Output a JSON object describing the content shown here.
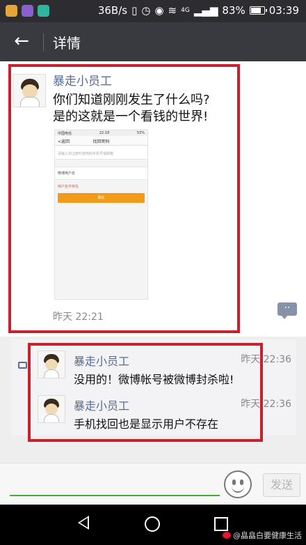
{
  "status_bar": {
    "speed": "36B/s",
    "network": "4G",
    "battery": "83%",
    "time": "03:39",
    "battery_level": 0.83
  },
  "header": {
    "back_icon": "arrow-left-icon",
    "title": "详情"
  },
  "post": {
    "author": "暴走小员工",
    "text": "你们知道刚刚发生了什么吗?\n是的这就是一个看钱的世界!",
    "screenshot": {
      "carrier": "中国电信",
      "time": "22:18",
      "battery": "53%",
      "back": "<返回",
      "title": "找回密码",
      "hint": "请输入你注册时使用的手机号或邮箱",
      "field": "微博用户名",
      "error": "用户名不存在",
      "button": "确定"
    },
    "time": "昨天 22:21"
  },
  "comments": [
    {
      "author": "暴走小员工",
      "time": "昨天 22:36",
      "text": "没用的！微博帐号被微博封杀啦!"
    },
    {
      "author": "暴走小员工",
      "time": "昨天 22:36",
      "text": "手机找回也是显示用户不存在"
    }
  ],
  "input_bar": {
    "send_label": "发送",
    "emoji_icon": "smiley-icon"
  },
  "watermark": "@皛皛白要健康生活",
  "colors": {
    "accent_name": "#576b95",
    "highlight_box": "#c8202c",
    "input_underline": "#3cb034",
    "header_bg": "#393a3f"
  }
}
